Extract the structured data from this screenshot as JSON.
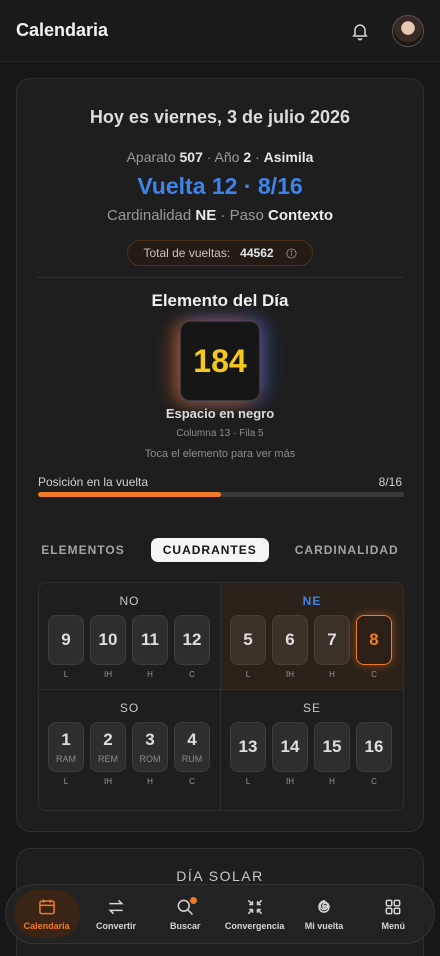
{
  "header": {
    "title": "Calendaria"
  },
  "today": {
    "date_line": "Hoy es viernes, 3 de julio 2026",
    "aparato_label": "Aparato",
    "aparato_value": "507",
    "ano_label": "Año",
    "ano_value": "2",
    "asimila": "Asimila",
    "vuelta": "Vuelta 12 · 8/16",
    "cardinalidad_label": "Cardinalidad",
    "cardinalidad_value": "NE",
    "paso_label": "Paso",
    "paso_value": "Contexto",
    "total_label": "Total de vueltas:",
    "total_value": "44562"
  },
  "element": {
    "title": "Elemento del Día",
    "number": "184",
    "name": "Espacio en negro",
    "position": "Columna 13 · Fila 5",
    "hint": "Toca el elemento para ver más"
  },
  "progress": {
    "label": "Posición en la vuelta",
    "value_text": "8/16",
    "fraction": 0.5
  },
  "tabs": [
    {
      "label": "ELEMENTOS",
      "active": false
    },
    {
      "label": "CUADRANTES",
      "active": true
    },
    {
      "label": "CARDINALIDAD",
      "active": false
    }
  ],
  "quadrants": [
    {
      "name": "NO",
      "highlight": false,
      "tiles": [
        {
          "num": "9",
          "sub": "",
          "label": "L"
        },
        {
          "num": "10",
          "sub": "",
          "label": "IH"
        },
        {
          "num": "11",
          "sub": "",
          "label": "H"
        },
        {
          "num": "12",
          "sub": "",
          "label": "C"
        }
      ]
    },
    {
      "name": "NE",
      "highlight": true,
      "tiles": [
        {
          "num": "5",
          "sub": "",
          "label": "L"
        },
        {
          "num": "6",
          "sub": "",
          "label": "IH"
        },
        {
          "num": "7",
          "sub": "",
          "label": "H"
        },
        {
          "num": "8",
          "sub": "",
          "label": "C",
          "active": true
        }
      ]
    },
    {
      "name": "SO",
      "highlight": false,
      "tiles": [
        {
          "num": "1",
          "sub": "RAM",
          "label": "L"
        },
        {
          "num": "2",
          "sub": "REM",
          "label": "IH"
        },
        {
          "num": "3",
          "sub": "ROM",
          "label": "H"
        },
        {
          "num": "4",
          "sub": "RUM",
          "label": "C"
        }
      ]
    },
    {
      "name": "SE",
      "highlight": false,
      "tiles": [
        {
          "num": "13",
          "sub": "",
          "label": "L"
        },
        {
          "num": "14",
          "sub": "",
          "label": "IH"
        },
        {
          "num": "15",
          "sub": "",
          "label": "H"
        },
        {
          "num": "16",
          "sub": "",
          "label": "C"
        }
      ]
    }
  ],
  "solar": {
    "title": "DÍA SOLAR"
  },
  "nav": {
    "items": [
      {
        "label": "Calendaria",
        "icon": "calendar-icon",
        "active": true
      },
      {
        "label": "Convertir",
        "icon": "swap-arrows-icon"
      },
      {
        "label": "Buscar",
        "icon": "search-icon",
        "badge": true
      },
      {
        "label": "Convergencia",
        "icon": "converge-icon"
      },
      {
        "label": "Mi vuelta",
        "icon": "spiral-icon"
      },
      {
        "label": "Menú",
        "icon": "grid-menu-icon"
      }
    ]
  },
  "colors": {
    "accent_blue": "#3f84ea",
    "accent_orange": "#f07a26",
    "element_yellow": "#f6c81c",
    "background": "#171717"
  }
}
